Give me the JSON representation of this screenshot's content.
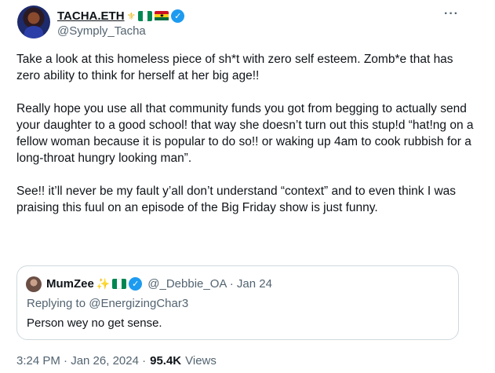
{
  "author": {
    "display_name": "TACHA.ETH",
    "emojis": [
      "trident",
      "flag-nigeria",
      "flag-ghana"
    ],
    "verified": true,
    "handle": "@Symply_Tacha"
  },
  "tweet": {
    "paragraphs": [
      "Take a look at this homeless piece of sh*t with zero self esteem. Zomb*e that has zero ability to think for herself at her big age!!",
      "Really hope you use all that community funds you got from begging to actually send your daughter to a good school! that way she doesn’t turn out this stup!d “hat!ng on a fellow woman because it is popular to do so!! or waking up 4am to cook rubbish for a long-throat hungry looking man”.",
      "See!! it’ll never be my fault y’all don’t understand “context” and to even think I was praising this fuul on an episode of the Big Friday show is just funny."
    ],
    "more_icon": "ellipsis-icon",
    "more_glyph": "···"
  },
  "quote": {
    "display_name": "MumZee",
    "emojis": [
      "sparkles",
      "flag-nigeria"
    ],
    "sparkle_glyph": "✨",
    "verified": true,
    "handle_date": "@_Debbie_OA · Jan 24",
    "replying_to": "Replying to @EnergizingChar3",
    "text": "Person wey no get sense."
  },
  "meta": {
    "time_date": "3:24 PM · Jan 26, 2024 ·",
    "views_count": "95.4K",
    "views_label": "Views"
  },
  "colors": {
    "text": "#0f1419",
    "secondary": "#536471",
    "verified_blue": "#1d9bf0",
    "border": "#cfd9de"
  }
}
